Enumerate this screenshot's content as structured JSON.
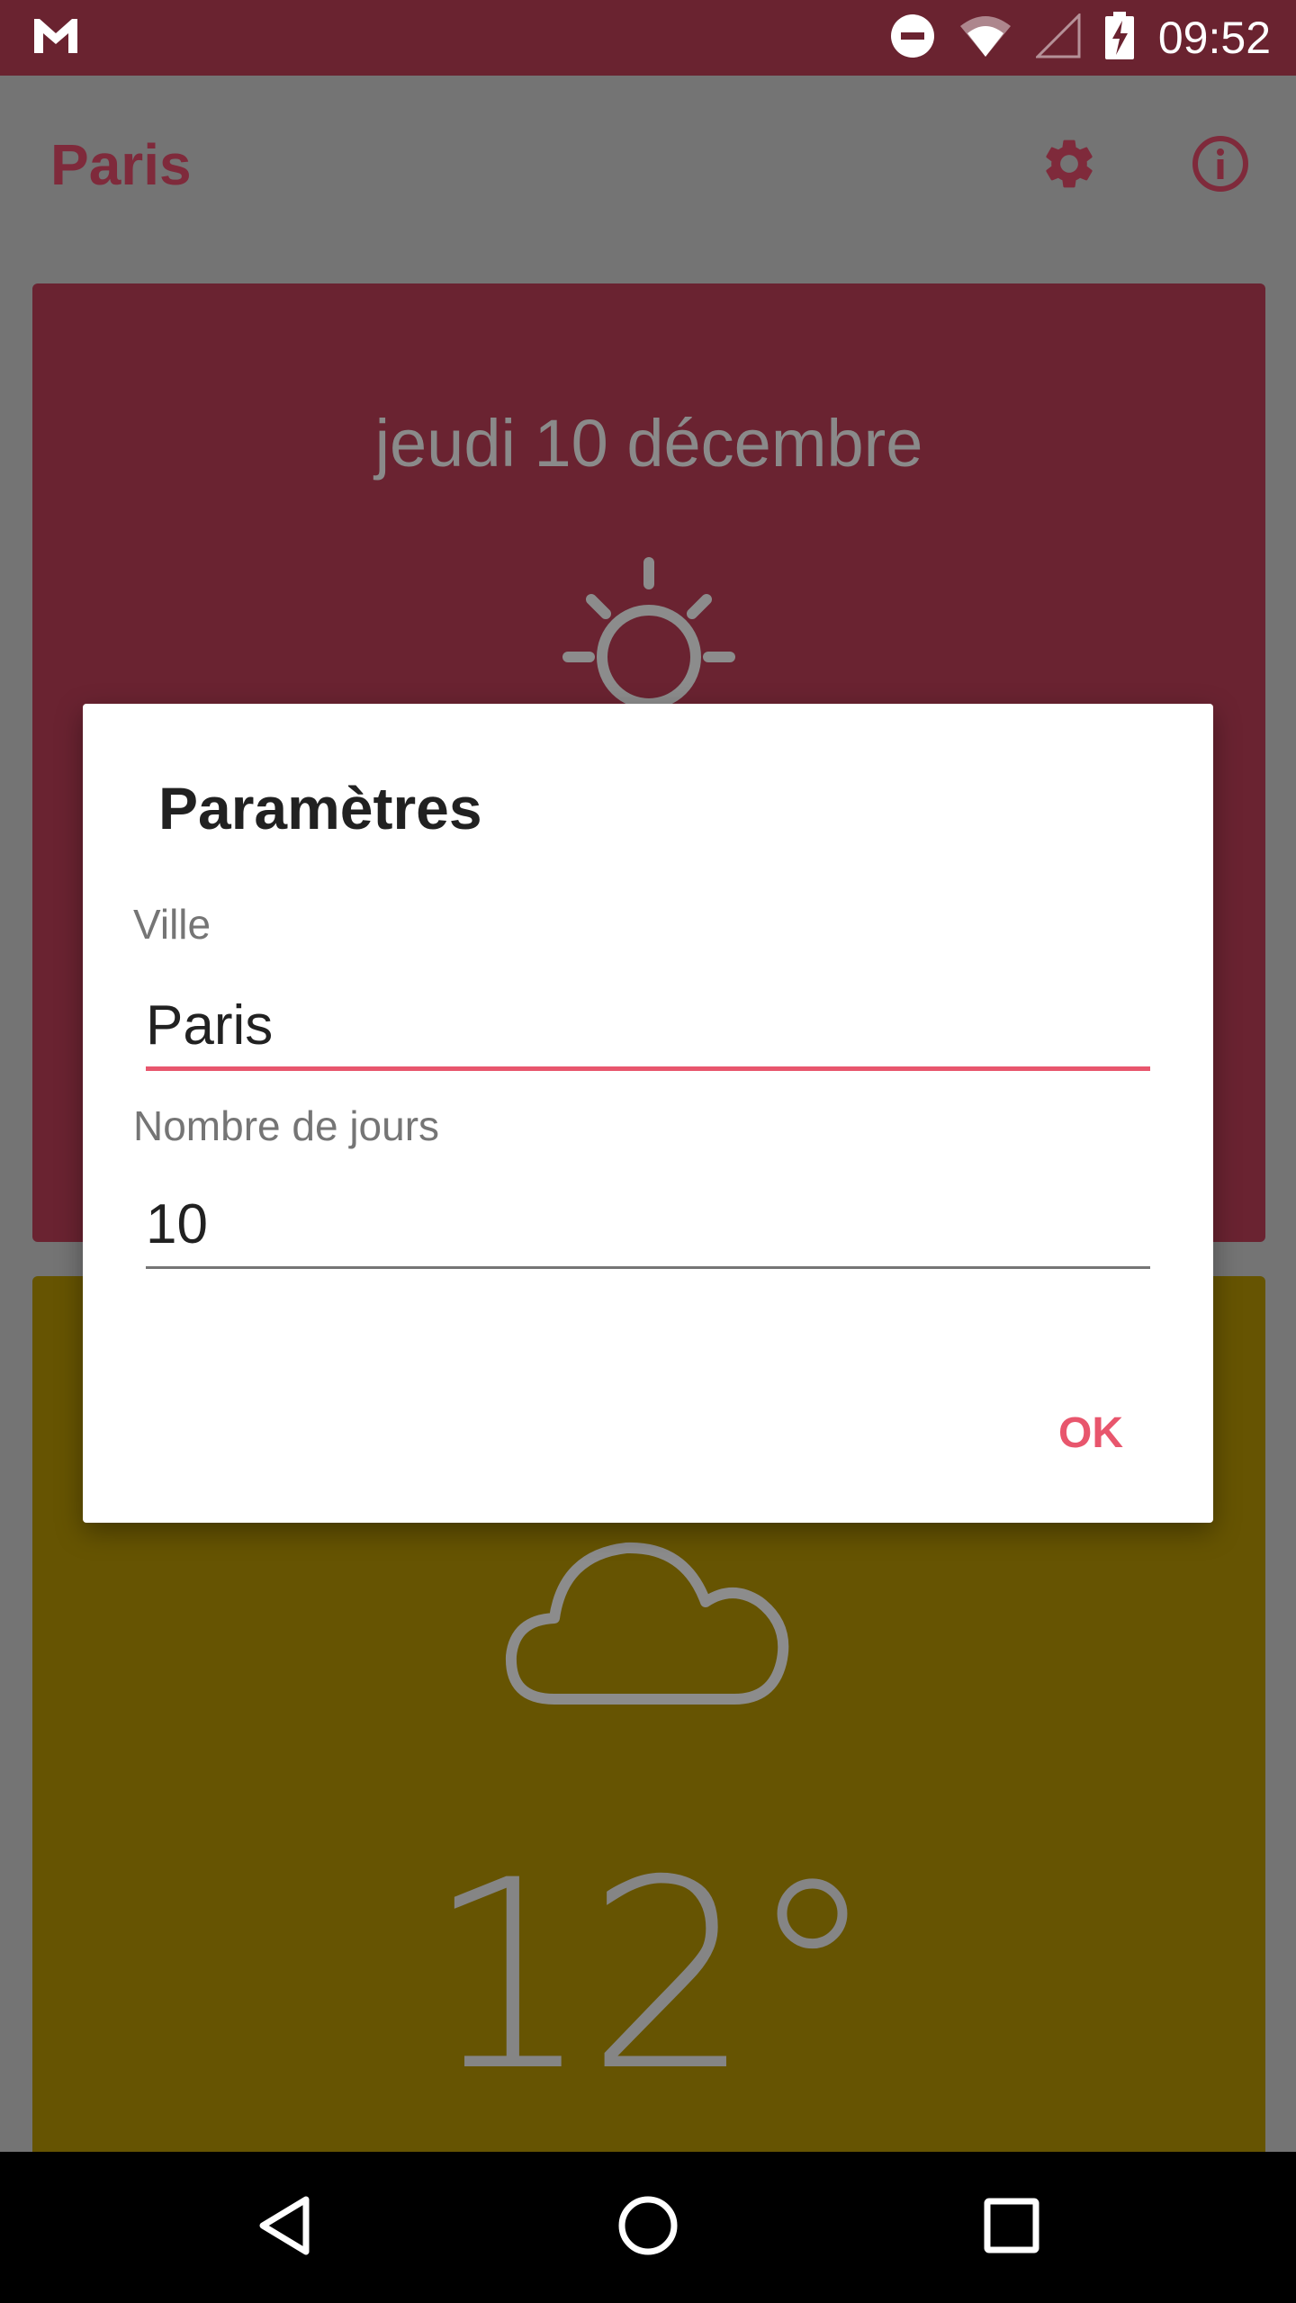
{
  "status_bar": {
    "time": "09:52",
    "icons": [
      "gmail-icon",
      "do-not-disturb-icon",
      "wifi-icon",
      "signal-icon",
      "battery-charging-icon"
    ]
  },
  "app_bar": {
    "title": "Paris",
    "icons": [
      "gear-icon",
      "info-icon"
    ]
  },
  "cards": [
    {
      "date": "jeudi 10 décembre",
      "icon": "sun-icon"
    },
    {
      "icon": "cloud-icon",
      "temperature": "12°"
    }
  ],
  "dialog": {
    "title": "Paramètres",
    "city_label": "Ville",
    "city_value": "Paris",
    "days_label": "Nombre de jours",
    "days_value": "10",
    "ok_label": "OK",
    "accent_color": "#e8566d"
  },
  "nav_bar": {
    "icons": [
      "back-icon",
      "home-icon",
      "recent-apps-icon"
    ]
  }
}
